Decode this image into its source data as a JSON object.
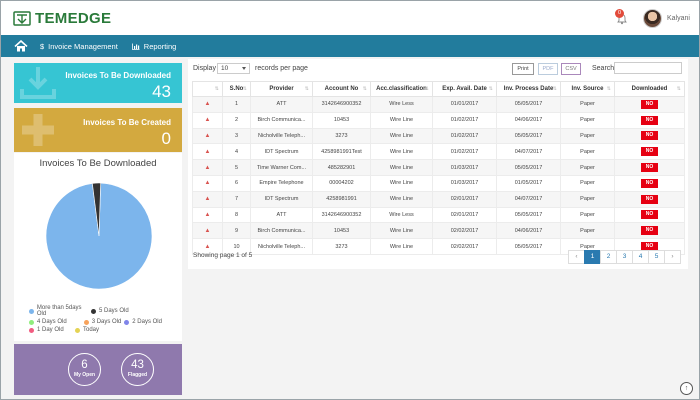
{
  "brand": {
    "name": "TEMEDGE",
    "color": "#2a7a3a"
  },
  "header": {
    "notification_count": "0",
    "username": "Kalyani"
  },
  "nav": {
    "items": [
      {
        "label": "Invoice Management",
        "icon": "dollar-icon"
      },
      {
        "label": "Reporting",
        "icon": "bar-chart-icon"
      }
    ]
  },
  "cards": {
    "download": {
      "title": "Invoices To Be Downloaded",
      "count": "43",
      "color": "#36c5d3"
    },
    "create": {
      "title": "Invoices To Be Created",
      "count": "0",
      "color": "#d3a93f"
    }
  },
  "chart_data": {
    "type": "pie",
    "title": "Invoices To Be Downloaded",
    "series": [
      {
        "name": "More than 5days Old",
        "value": 97.5,
        "color": "#7cb5ec"
      },
      {
        "name": "5 Days Old",
        "value": 2.5,
        "color": "#333333"
      },
      {
        "name": "4 Days Old",
        "value": 0,
        "color": "#90ed7d"
      },
      {
        "name": "3 Days Old",
        "value": 0,
        "color": "#f7a35c"
      },
      {
        "name": "2 Days Old",
        "value": 0,
        "color": "#8085e9"
      },
      {
        "name": "1 Day Old",
        "value": 0,
        "color": "#f15c80"
      },
      {
        "name": "Today",
        "value": 0,
        "color": "#e4d354"
      }
    ]
  },
  "stats": {
    "my_open": {
      "value": "6",
      "label": "My Open"
    },
    "flagged": {
      "value": "43",
      "label": "Flagged"
    }
  },
  "table_controls": {
    "display_label": "Display",
    "per_page": "10",
    "per_page_suffix": "records per page",
    "print": "Print",
    "pdf": "PDF",
    "csv": "CSV",
    "search_label": "Search:"
  },
  "table": {
    "columns": [
      "S.No",
      "Provider",
      "Account No",
      "Acc.classification",
      "Exp. Avail. Date",
      "Inv. Process Date",
      "Inv. Source",
      "Downloaded"
    ],
    "rows": [
      [
        "1",
        "ATT",
        "3142646900352",
        "Wire Less",
        "01/01/2017",
        "05/05/2017",
        "Paper",
        "NO"
      ],
      [
        "2",
        "Birch Communica...",
        "10453",
        "Wire Line",
        "01/02/2017",
        "04/06/2017",
        "Paper",
        "NO"
      ],
      [
        "3",
        "Nicholville Teleph...",
        "3273",
        "Wire Line",
        "01/02/2017",
        "05/05/2017",
        "Paper",
        "NO"
      ],
      [
        "4",
        "IDT Spectrum",
        "4258981991Test",
        "Wire Line",
        "01/02/2017",
        "04/07/2017",
        "Paper",
        "NO"
      ],
      [
        "5",
        "Time Warner Com...",
        "485282901",
        "Wire Line",
        "01/03/2017",
        "05/05/2017",
        "Paper",
        "NO"
      ],
      [
        "6",
        "Empire Telephone",
        "00004202",
        "Wire Line",
        "01/03/2017",
        "01/05/2017",
        "Paper",
        "NO"
      ],
      [
        "7",
        "IDT Spectrum",
        "4258981991",
        "Wire Line",
        "02/01/2017",
        "04/07/2017",
        "Paper",
        "NO"
      ],
      [
        "8",
        "ATT",
        "3142646900352",
        "Wire Less",
        "02/01/2017",
        "05/05/2017",
        "Paper",
        "NO"
      ],
      [
        "9",
        "Birch Communica...",
        "10453",
        "Wire Line",
        "02/02/2017",
        "04/06/2017",
        "Paper",
        "NO"
      ],
      [
        "10",
        "Nicholville Teleph...",
        "3273",
        "Wire Line",
        "02/02/2017",
        "05/05/2017",
        "Paper",
        "NO"
      ]
    ]
  },
  "pagination": {
    "summary": "Showing page 1 of 5",
    "pages": [
      "1",
      "2",
      "3",
      "4",
      "5"
    ],
    "prev": "‹",
    "next": "›",
    "active": "1"
  }
}
